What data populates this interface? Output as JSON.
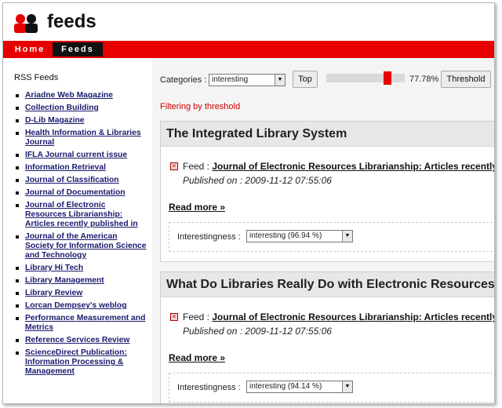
{
  "header": {
    "site_title": "feeds",
    "logo_icon": "people-icon"
  },
  "nav": {
    "items": [
      {
        "label": "Home"
      },
      {
        "label": "Feeds",
        "active": true
      }
    ]
  },
  "sidebar": {
    "title": "RSS Feeds",
    "feeds": [
      "Ariadne Web Magazine",
      "Collection Building",
      "D-Lib Magazine",
      "Health Information & Libraries Journal",
      "IFLA Journal current issue",
      "Information Retrieval",
      "Journal of Classification",
      "Journal of Documentation",
      "Journal of Electronic Resources Librarianship: Articles recently published in",
      "Journal of the American Society for Information Science and Technology",
      "Library Hi Tech",
      "Library Management",
      "Library Review",
      "Lorcan Dempsey's weblog",
      "Performance Measurement and Metrics",
      "Reference Services Review",
      "ScienceDirect Publication: Information Processing & Management"
    ]
  },
  "toolbar": {
    "categories_label": "Categories :",
    "categories_selected": "interesting",
    "top_label": "Top",
    "threshold_percent": 77.78,
    "threshold_value_text": "77.78%",
    "threshold_label": "Threshold"
  },
  "filter_message": "Filtering by threshold",
  "articles": [
    {
      "title": "The Integrated Library System",
      "feed_label": "Feed :",
      "feed_source": "Journal of Electronic Resources Librarianship: Articles recently",
      "published": "Published on : 2009-11-12 07:55:06",
      "read_more": "Read more »",
      "interest_label": "Interestingness :",
      "interest_value": "interesting (96.94 %)"
    },
    {
      "title": "What Do Libraries Really Do with Electronic Resources",
      "feed_label": "Feed :",
      "feed_source": "Journal of Electronic Resources Librarianship: Articles recently",
      "published": "Published on : 2009-11-12 07:55:06",
      "read_more": "Read more »",
      "interest_label": "Interestingness :",
      "interest_value": "interesting (94.14 %)"
    }
  ],
  "colors": {
    "accent": "#e60000",
    "nav_active": "#111111",
    "filter_text": "#d00000"
  }
}
